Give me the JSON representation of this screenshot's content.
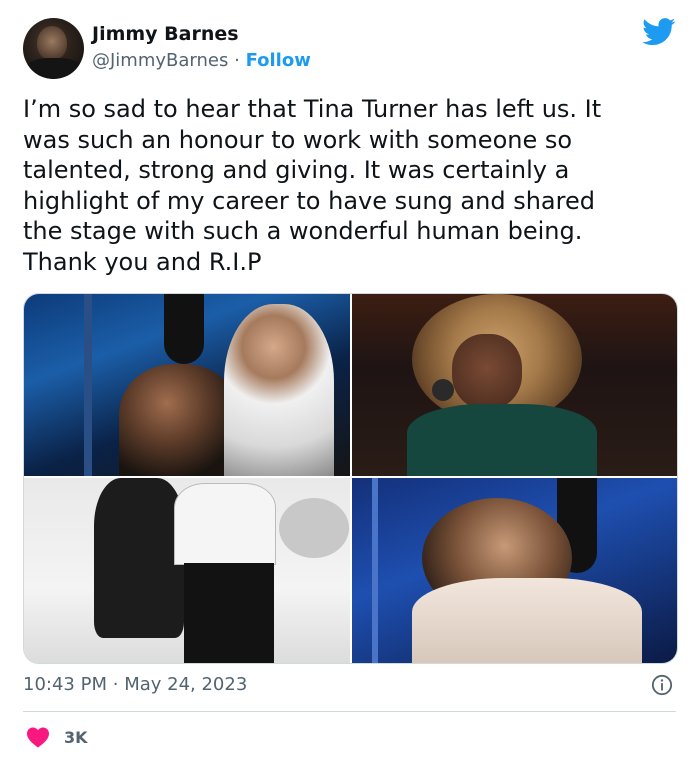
{
  "author": {
    "name": "Jimmy Barnes",
    "handle": "@JimmyBarnes",
    "separator": "·",
    "follow_label": "Follow",
    "avatar_icon": "avatar-photo"
  },
  "brand": {
    "icon": "twitter-bird-icon",
    "color": "#1d9bf0"
  },
  "tweet": {
    "text": "I’m so sad to hear that Tina Turner has left us. It\nwas such an honour to work with someone so\ntalented, strong and giving. It was certainly a\nhighlight of my career to have sung and shared\nthe stage with such a wonderful human being.\nThank you and R.I.P"
  },
  "media": {
    "photos": [
      {
        "description_icon": "studio-duet-photo"
      },
      {
        "description_icon": "singer-microphone-photo"
      },
      {
        "description_icon": "dancing-photo"
      },
      {
        "description_icon": "hug-photo"
      }
    ]
  },
  "meta": {
    "time": "10:43 PM",
    "separator": "·",
    "date": "May 24, 2023",
    "info_icon": "info-icon"
  },
  "engagement": {
    "likes": "3K",
    "like_icon": "heart-icon",
    "like_color": "#f91880"
  },
  "colors": {
    "text": "#0f1419",
    "secondary": "#536471",
    "link": "#1d9bf0",
    "border": "#cfd9de"
  }
}
